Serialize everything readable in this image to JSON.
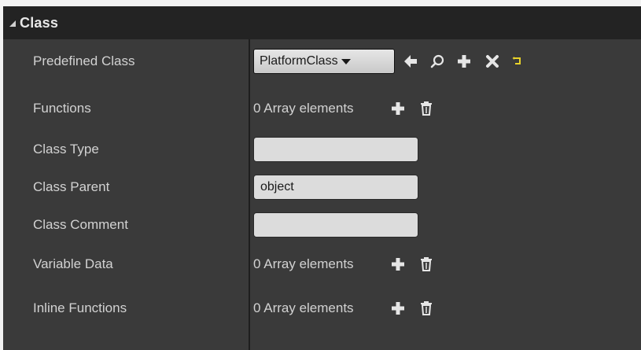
{
  "section": {
    "title": "Class"
  },
  "rows": [
    {
      "label": "Predefined Class",
      "combo_value": "PlatformClass"
    },
    {
      "label": "Functions",
      "value": "0 Array elements"
    },
    {
      "label": "Class Type",
      "value": ""
    },
    {
      "label": "Class Parent",
      "value": "object"
    },
    {
      "label": "Class Comment",
      "value": ""
    },
    {
      "label": "Variable Data",
      "value": "0 Array elements"
    },
    {
      "label": "Inline Functions",
      "value": "0 Array elements"
    }
  ],
  "icons": {
    "use_selected": "arrow-left-icon",
    "browse": "search-icon",
    "new": "plus-icon",
    "clear": "close-icon",
    "reset": "reset-arrow-icon",
    "add_element": "plus-icon",
    "remove_all": "trash-icon"
  },
  "colors": {
    "panel_bg": "#3a3a3a",
    "header_bg": "#232323",
    "label_text": "#d2d2d2",
    "reset_accent": "#e8d22a"
  }
}
